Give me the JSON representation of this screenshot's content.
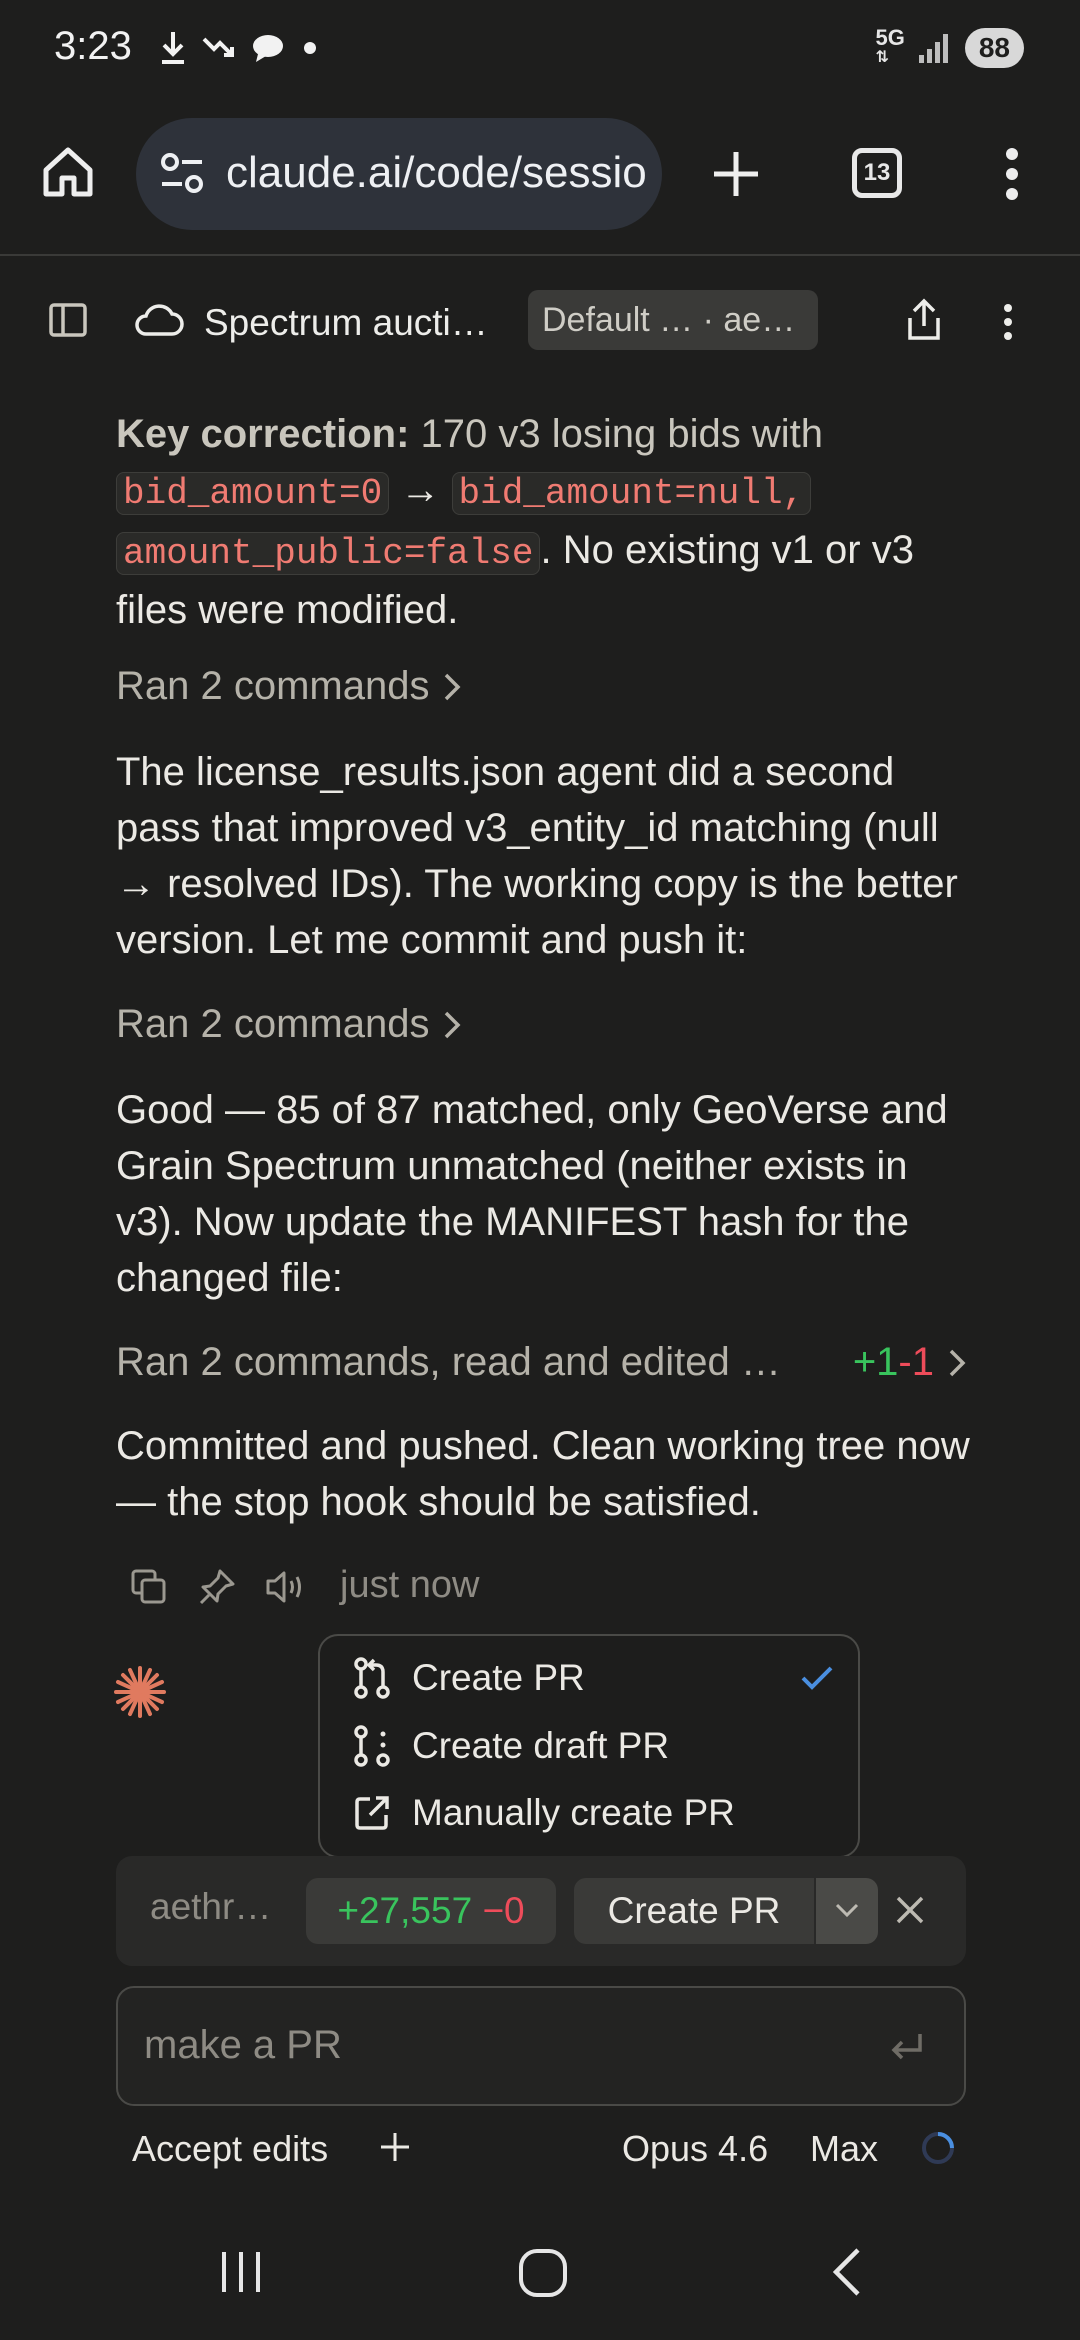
{
  "status_bar": {
    "time": "3:23",
    "network": "5G",
    "battery": "88"
  },
  "browser": {
    "url": "claude.ai/code/sessio",
    "tab_count": "13"
  },
  "session": {
    "title": "Spectrum aucti…",
    "branch": "Default … · ae…"
  },
  "messages": {
    "p1_bold": "Key correction:",
    "p1_text1": "170 v3 losing bids with",
    "p1_code1": "bid_amount=0",
    "p1_arrow": "→",
    "p1_code2": "bid_amount=null,",
    "p1_code3": "amount_public=false",
    "p1_text2": ". No existing v1 or v3 files were modified.",
    "cmd1": "Ran 2 commands",
    "p2": "The license_results.json agent did a second pass that improved v3_entity_id matching (null → resolved IDs). The working copy is the better version. Let me commit and push it:",
    "cmd2": "Ran 2 commands",
    "p3": "Good — 85 of 87 matched, only GeoVerse and Grain Spectrum unmatched (neither exists in v3). Now update the MANIFEST hash for the changed file:",
    "cmd3": "Ran 2 commands, read and edited …",
    "cmd3_add": "+1",
    "cmd3_del": "-1",
    "p4": "Committed and pushed. Clean working tree now — the stop hook should be satisfied.",
    "timestamp": "just now"
  },
  "pr_menu": {
    "items": [
      {
        "label": "Create PR",
        "icon": "pull-request-icon",
        "selected": true
      },
      {
        "label": "Create draft PR",
        "icon": "draft-pr-icon",
        "selected": false
      },
      {
        "label": "Manually create PR",
        "icon": "external-link-icon",
        "selected": false
      }
    ]
  },
  "pr_bar": {
    "branch": "aethr…",
    "additions": "+27,557",
    "deletions": "−0",
    "button_label": "Create PR"
  },
  "input": {
    "placeholder": "make a PR"
  },
  "bottom_toolbar": {
    "mode": "Accept edits",
    "model": "Opus 4.6",
    "effort": "Max"
  },
  "colors": {
    "background": "#1e1e1d",
    "accent_orange": "#e07a5f",
    "addition_green": "#39c45d",
    "deletion_red": "#ee4c5a",
    "check_blue": "#4a8fe0"
  }
}
